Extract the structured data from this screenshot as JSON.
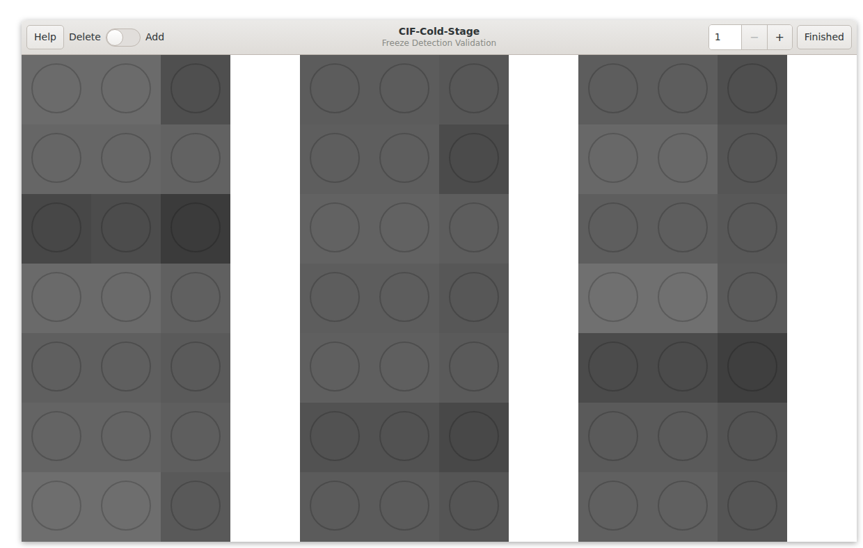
{
  "window": {
    "title": "CIF-Cold-Stage",
    "subtitle": "Freeze Detection Validation"
  },
  "header": {
    "help": "Help",
    "mode": {
      "off_label": "Delete",
      "on_label": "Add",
      "on": false
    },
    "spin": {
      "value": "1",
      "minus": "−",
      "plus": "+",
      "minus_disabled": true,
      "plus_disabled": false
    },
    "finished": "Finished"
  },
  "columns": [
    {
      "wells": [
        {
          "frames": [
            {
              "color": "#6b6b6b"
            },
            {
              "color": "#6b6b6b"
            },
            {
              "color": "#4f4f4f"
            }
          ]
        },
        {
          "frames": [
            {
              "color": "#666666"
            },
            {
              "color": "#666666"
            },
            {
              "color": "#626262"
            }
          ]
        },
        {
          "frames": [
            {
              "color": "#474747"
            },
            {
              "color": "#4c4c4c"
            },
            {
              "color": "#3b3b3b"
            }
          ]
        },
        {
          "frames": [
            {
              "color": "#6a6a6a"
            },
            {
              "color": "#6a6a6a"
            },
            {
              "color": "#606060"
            }
          ]
        },
        {
          "frames": [
            {
              "color": "#5f5f5f"
            },
            {
              "color": "#5f5f5f"
            },
            {
              "color": "#5a5a5a"
            }
          ]
        },
        {
          "frames": [
            {
              "color": "#646464"
            },
            {
              "color": "#646464"
            },
            {
              "color": "#5e5e5e"
            }
          ]
        },
        {
          "frames": [
            {
              "color": "#6e6e6e"
            },
            {
              "color": "#6e6e6e"
            },
            {
              "color": "#595959"
            }
          ]
        }
      ]
    },
    {
      "wells": [
        {
          "frames": [
            {
              "color": "#5c5c5c"
            },
            {
              "color": "#5c5c5c"
            },
            {
              "color": "#575757"
            }
          ]
        },
        {
          "frames": [
            {
              "color": "#5e5e5e"
            },
            {
              "color": "#5e5e5e"
            },
            {
              "color": "#4b4b4b"
            }
          ]
        },
        {
          "frames": [
            {
              "color": "#626262"
            },
            {
              "color": "#626262"
            },
            {
              "color": "#5d5d5d"
            }
          ]
        },
        {
          "frames": [
            {
              "color": "#5d5d5d"
            },
            {
              "color": "#5d5d5d"
            },
            {
              "color": "#575757"
            }
          ]
        },
        {
          "frames": [
            {
              "color": "#5f5f5f"
            },
            {
              "color": "#5f5f5f"
            },
            {
              "color": "#5a5a5a"
            }
          ]
        },
        {
          "frames": [
            {
              "color": "#525252"
            },
            {
              "color": "#525252"
            },
            {
              "color": "#484848"
            }
          ]
        },
        {
          "frames": [
            {
              "color": "#5b5b5b"
            },
            {
              "color": "#5b5b5b"
            },
            {
              "color": "#555555"
            }
          ]
        }
      ]
    },
    {
      "wells": [
        {
          "frames": [
            {
              "color": "#5d5d5d"
            },
            {
              "color": "#5d5d5d"
            },
            {
              "color": "#4f4f4f"
            }
          ]
        },
        {
          "frames": [
            {
              "color": "#686868"
            },
            {
              "color": "#686868"
            },
            {
              "color": "#555555"
            }
          ]
        },
        {
          "frames": [
            {
              "color": "#5e5e5e"
            },
            {
              "color": "#5e5e5e"
            },
            {
              "color": "#585858"
            }
          ]
        },
        {
          "frames": [
            {
              "color": "#707070"
            },
            {
              "color": "#707070"
            },
            {
              "color": "#5a5a5a"
            }
          ]
        },
        {
          "frames": [
            {
              "color": "#4b4b4b"
            },
            {
              "color": "#4b4b4b"
            },
            {
              "color": "#3f3f3f"
            }
          ]
        },
        {
          "frames": [
            {
              "color": "#5a5a5a"
            },
            {
              "color": "#5a5a5a"
            },
            {
              "color": "#535353"
            }
          ]
        },
        {
          "frames": [
            {
              "color": "#606060"
            },
            {
              "color": "#606060"
            },
            {
              "color": "#555555"
            }
          ]
        }
      ]
    }
  ]
}
